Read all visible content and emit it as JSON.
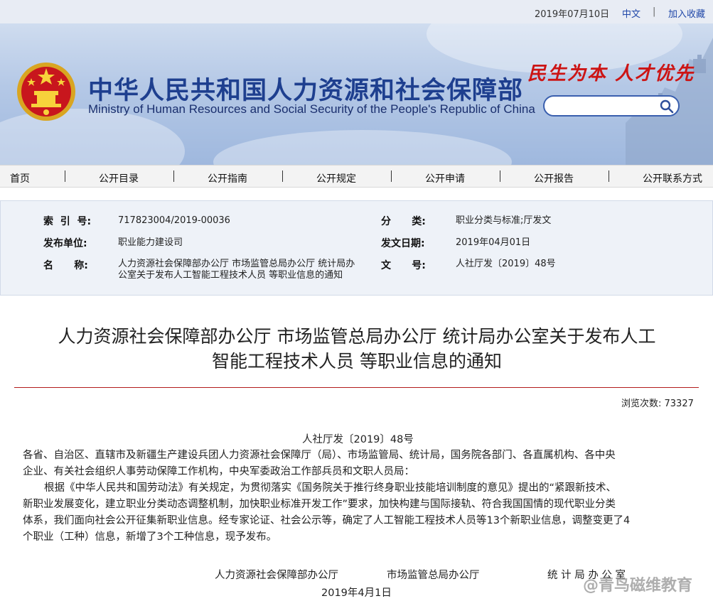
{
  "topbar": {
    "date": "2019年07月10日",
    "lang": "中文",
    "separator": "|",
    "favorite": "加入收藏"
  },
  "header": {
    "title_cn": "中华人民共和国人力资源和社会保障部",
    "title_en": "Ministry of Human Resources and Social Security of the People's Republic of China",
    "slogan": "民生为本 人才优先",
    "search_placeholder": ""
  },
  "nav": {
    "items": [
      "首页",
      "公开目录",
      "公开指南",
      "公开规定",
      "公开申请",
      "公开报告",
      "公开联系方式"
    ]
  },
  "info": {
    "index_label": "索  引  号:",
    "index_value": "717823004/2019-00036",
    "category_label": "分      类:",
    "category_value": "职业分类与标准;厅发文",
    "publisher_label": "发布单位:",
    "publisher_value": "职业能力建设司",
    "date_label": "发文日期:",
    "date_value": "2019年04月01日",
    "name_label": "名      称:",
    "name_value": "人力资源社会保障部办公厅 市场监管总局办公厅 统计局办公室关于发布人工智能工程技术人员 等职业信息的通知",
    "docno_label": "文      号:",
    "docno_value": "人社厅发〔2019〕48号"
  },
  "article": {
    "title_line1": "人力资源社会保障部办公厅 市场监管总局办公厅 统计局办公室关于发布人工",
    "title_line2": "智能工程技术人员 等职业信息的通知",
    "views": "浏览次数: 73327",
    "docno": "人社厅发〔2019〕48号",
    "p1_line1": "各省、自治区、直辖市及新疆生产建设兵团人力资源社会保障厅（局）、市场监管局、统计局，国务院各部门、各直属机构、各中央",
    "p1_line2": "企业、有关社会组织人事劳动保障工作机构，中央军委政治工作部兵员和文职人员局：",
    "p2_line1": "根据《中华人民共和国劳动法》有关规定，为贯彻落实《国务院关于推行终身职业技能培训制度的意见》提出的“紧跟新技术、",
    "p2_line2": "新职业发展变化，建立职业分类动态调整机制，加快职业标准开发工作”要求，加快构建与国际接轨、符合我国国情的现代职业分类",
    "p2_line3": "体系，我们面向社会公开征集新职业信息。经专家论证、社会公示等，确定了人工智能工程技术人员等13个新职业信息，调整变更了4",
    "p2_line4": "个职业（工种）信息，新增了3个工种信息，现予发布。",
    "sign1": "人力资源社会保障部办公厅",
    "sign2": "市场监管总局办公厅",
    "sign3": "统 计 局 办 公 室",
    "sign_date": "2019年4月1日",
    "watermark": "@青鸟磁维教育"
  },
  "colors": {
    "accent": "#1e3f8f",
    "slogan": "#cc1414",
    "rule": "#b31b1b"
  }
}
